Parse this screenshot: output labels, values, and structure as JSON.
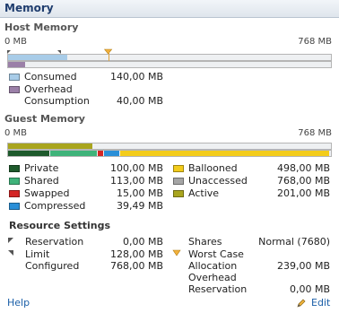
{
  "panel": {
    "title": "Memory"
  },
  "host_memory": {
    "title": "Host Memory",
    "axis_min": "0 MB",
    "axis_max": "768 MB",
    "consumed_fraction": 0.182,
    "overhead_fraction": 0.052,
    "consumption_fraction": 0.052,
    "marker_fraction": 0.31,
    "legend": [
      {
        "key": "consumed",
        "label": "Consumed",
        "value": "140,00 MB",
        "color": "#a8cce8"
      },
      {
        "key": "overhead",
        "label": "Overhead",
        "value": "",
        "color": "#9b80a8"
      },
      {
        "key": "consumption",
        "label": "Consumption",
        "value": "40,00 MB",
        "color": ""
      }
    ]
  },
  "guest_memory": {
    "title": "Guest Memory",
    "axis_min": "0 MB",
    "axis_max": "768 MB",
    "active_fraction": 0.262,
    "breakdown_fractions": {
      "private": 0.13,
      "shared": 0.147,
      "swapped": 0.02,
      "compressed": 0.051,
      "ballooned": 0.648
    },
    "left_legend": [
      {
        "key": "private",
        "label": "Private",
        "value": "100,00 MB",
        "color": "#1e5a2c"
      },
      {
        "key": "shared",
        "label": "Shared",
        "value": "113,00 MB",
        "color": "#3fb37a"
      },
      {
        "key": "swapped",
        "label": "Swapped",
        "value": "15,00 MB",
        "color": "#d42525"
      },
      {
        "key": "compressed",
        "label": "Compressed",
        "value": "39,49 MB",
        "color": "#2a8fd8"
      }
    ],
    "right_legend": [
      {
        "key": "ballooned",
        "label": "Ballooned",
        "value": "498,00 MB",
        "color": "#f3cc1b"
      },
      {
        "key": "unaccessed",
        "label": "Unaccessed",
        "value": "768,00 MB",
        "color": "#a5a5a5"
      },
      {
        "key": "active",
        "label": "Active",
        "value": "201,00 MB",
        "color": "#a9a51e"
      }
    ]
  },
  "resource_settings": {
    "title": "Resource Settings",
    "left": [
      {
        "key": "reservation",
        "label": "Reservation",
        "value": "0,00 MB"
      },
      {
        "key": "limit",
        "label": "Limit",
        "value": "128,00 MB"
      },
      {
        "key": "configured",
        "label": "Configured",
        "value": "768,00 MB"
      }
    ],
    "right": [
      {
        "key": "shares",
        "label": "Shares",
        "value": "Normal (7680)"
      },
      {
        "key": "worst_case",
        "label": "Worst Case",
        "value": ""
      },
      {
        "key": "allocation",
        "label": "Allocation",
        "value": "239,00 MB"
      },
      {
        "key": "overhead_reservation_1",
        "label": "Overhead",
        "value": ""
      },
      {
        "key": "overhead_reservation_2",
        "label": "Reservation",
        "value": "0,00 MB"
      }
    ]
  },
  "footer": {
    "help_label": "Help",
    "edit_label": "Edit"
  }
}
